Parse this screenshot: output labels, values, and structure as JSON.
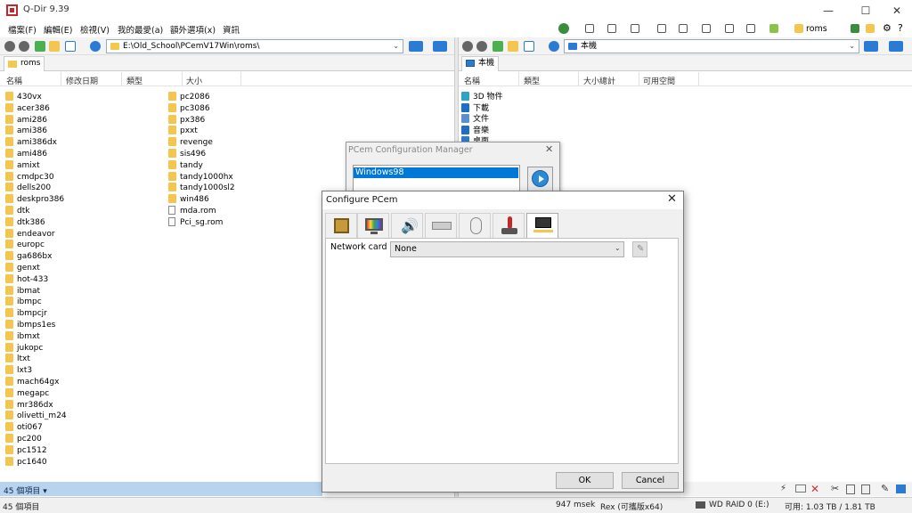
{
  "app": {
    "title": "Q-Dir 9.39",
    "window_controls": [
      "minimize",
      "maximize",
      "close"
    ]
  },
  "menu": [
    "檔案(F)",
    "編輯(E)",
    "檢視(V)",
    "我的最愛(a)",
    "額外選項(x)",
    "資訊"
  ],
  "left_pane": {
    "path": "E:\\Old_School\\PCemV17Win\\roms\\",
    "tab": "roms",
    "columns": [
      "名稱",
      "修改日期",
      "類型",
      "大小"
    ],
    "col1": [
      "430vx",
      "acer386",
      "ami286",
      "ami386",
      "ami386dx",
      "ami486",
      "amixt",
      "cmdpc30",
      "dells200",
      "deskpro386",
      "dtk",
      "dtk386",
      "endeavor",
      "europc",
      "ga686bx",
      "genxt",
      "hot-433",
      "ibmat",
      "ibmpc",
      "ibmpcjr",
      "ibmps1es",
      "ibmxt",
      "jukopc",
      "ltxt",
      "lxt3",
      "mach64gx",
      "megapc",
      "mr386dx",
      "olivetti_m24",
      "oti067",
      "pc200",
      "pc1512",
      "pc1640"
    ],
    "col2_folders": [
      "pc2086",
      "pc3086",
      "px386",
      "pxxt",
      "revenge",
      "sis496",
      "tandy",
      "tandy1000hx",
      "tandy1000sl2",
      "win486"
    ],
    "col2_files": [
      "mda.rom",
      "Pci_sg.rom"
    ],
    "count_label": "45 個項目"
  },
  "right_pane": {
    "path": "本機",
    "tab": "本機",
    "columns": [
      "名稱",
      "類型",
      "大小總計",
      "可用空間"
    ],
    "items": [
      "3D 物件",
      "下載",
      "文件",
      "音樂",
      "桌面"
    ],
    "toolbar_label": "roms"
  },
  "status": {
    "items_label": "45 個項目",
    "time": "947 msek",
    "version": "Rex (可攜版x64)",
    "drive": "WD RAID 0 (E:)",
    "free": "可用: 1.03 TB / 1.81 TB"
  },
  "manager": {
    "title": "PCem Configuration Manager",
    "selected_config": "Windows98"
  },
  "configure": {
    "title": "Configure PCem",
    "tabs": [
      "motherboard-icon",
      "display-icon",
      "sound-icon",
      "drives-icon",
      "mouse-icon",
      "joystick-icon",
      "network-icon"
    ],
    "selected_tab": 6,
    "network_label": "Network card",
    "network_value": "None",
    "ok_label": "OK",
    "cancel_label": "Cancel"
  },
  "colors": {
    "accent": "#0078d7",
    "folder": "#f4c64f",
    "status_bar_blue": "#b8d3ee"
  }
}
